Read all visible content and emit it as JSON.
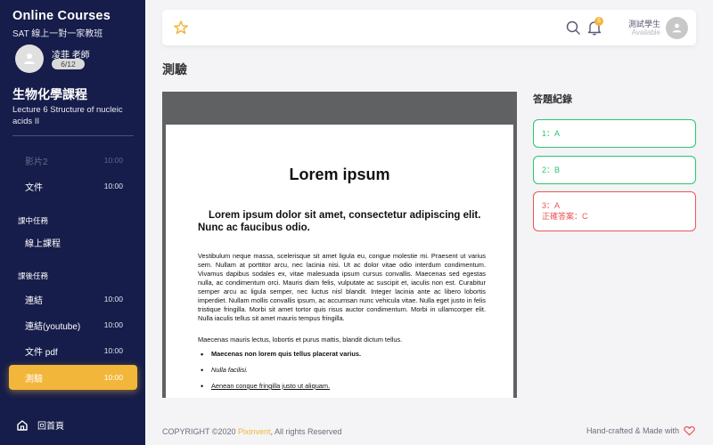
{
  "sidebar": {
    "brand_title": "Online Courses",
    "brand_subtitle": "SAT 線上一對一家教班",
    "teacher_name": "凌菲 老師",
    "progress": "6/12",
    "course_title": "生物化學課程",
    "lecture": "Lecture 6 Structure of nucleic acids II",
    "items": [
      {
        "label": "影片2",
        "time": "10:00",
        "faded": true
      },
      {
        "label": "文件",
        "time": "10:00"
      },
      {
        "label": "線上課程",
        "time": ""
      },
      {
        "label": "連結",
        "time": "10:00"
      },
      {
        "label": "連結(youtube)",
        "time": "10:00"
      },
      {
        "label": "文件 pdf",
        "time": "10:00"
      },
      {
        "label": "測驗",
        "time": "10:00",
        "active": true
      }
    ],
    "sections": [
      "課中任務",
      "課後任務"
    ],
    "home_label": "回首頁"
  },
  "navbar": {
    "bell_count": "5",
    "user_name": "測試學生",
    "user_status": "Available"
  },
  "page_title": "測驗",
  "document": {
    "title": "Lorem ipsum",
    "subtitle": "Lorem ipsum dolor sit amet, consectetur adipiscing elit. Nunc ac faucibus odio.",
    "para1": "Vestibulum neque massa, scelerisque sit amet ligula eu, congue molestie mi. Praesent ut varius sem. Nullam at porttitor arcu, nec lacinia nisi. Ut ac dolor vitae odio interdum condimentum. Vivamus dapibus sodales ex, vitae malesuada ipsum cursus convallis. Maecenas sed egestas nulla, ac condimentum orci. Mauris diam felis, vulputate ac suscipit et, iaculis non est. Curabitur semper arcu ac ligula semper, nec luctus nisl blandit. Integer lacinia ante ac libero lobortis imperdiet. Nullam mollis convallis ipsum, ac accumsan nunc vehicula vitae. Nulla eget justo in felis tristique fringilla. Morbi sit amet tortor quis risus auctor condimentum. Morbi in ullamcorper elit. Nulla iaculis tellus sit amet mauris tempus fringilla.",
    "para2": "Maecenas mauris lectus, lobortis et purus mattis, blandit dictum tellus.",
    "list": [
      "Maecenas non lorem quis tellus placerat varius.",
      "Nulla facilisi.",
      "Aenean congue fringilla justo ut aliquam."
    ]
  },
  "records": {
    "title": "答題紀錄",
    "items": [
      {
        "line1": "1：A",
        "status": "correct"
      },
      {
        "line1": "2：B",
        "status": "correct"
      },
      {
        "line1": "3：A",
        "line2": "正確答案：C",
        "status": "wrong"
      }
    ]
  },
  "footer": {
    "copyright_prefix": "COPYRIGHT ©2020 ",
    "brand": "Pixinvent",
    "copyright_suffix": ", All rights Reserved",
    "right_text": "Hand-crafted & Made with"
  },
  "colors": {
    "sidebar_bg": "#161d4a",
    "accent": "#f2b63a",
    "success": "#28c76f",
    "danger": "#ea5455"
  }
}
